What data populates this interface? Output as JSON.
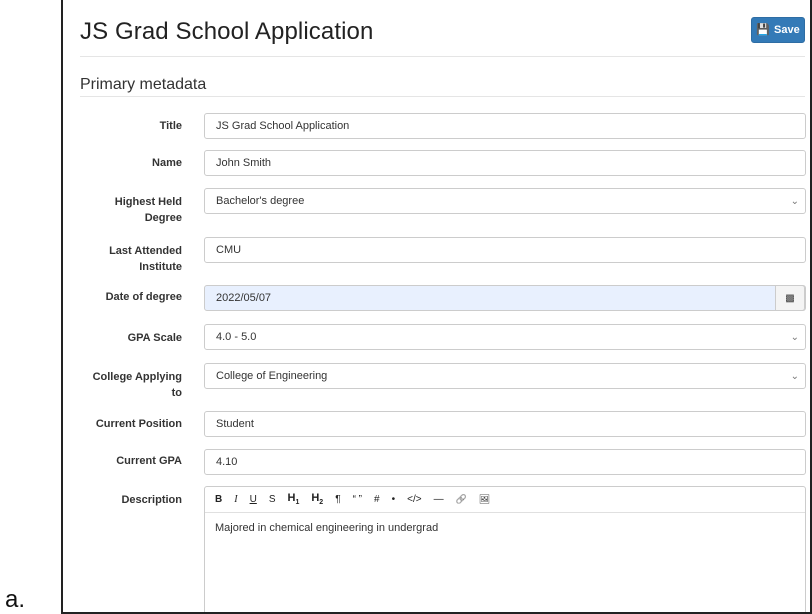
{
  "caption": "a.",
  "header": {
    "title": "JS Grad School Application",
    "save_label": "Save",
    "save_icon": "floppy-disk-icon"
  },
  "section": {
    "title": "Primary metadata"
  },
  "fields": {
    "title": {
      "label": "Title",
      "value": "JS Grad School Application"
    },
    "name": {
      "label": "Name",
      "value": "John Smith"
    },
    "degree": {
      "label1": "Highest Held",
      "label2": "Degree",
      "value": "Bachelor's degree"
    },
    "institute": {
      "label1": "Last Attended",
      "label2": "Institute",
      "value": "CMU"
    },
    "date": {
      "label": "Date of degree",
      "value": "2022/05/07",
      "icon": "calendar-icon"
    },
    "gpa_scale": {
      "label": "GPA Scale",
      "value": "4.0 - 5.0"
    },
    "college": {
      "label1": "College Applying",
      "label2": "to",
      "value": "College of Engineering"
    },
    "position": {
      "label": "Current Position",
      "value": "Student"
    },
    "gpa": {
      "label": "Current GPA",
      "value": "4.10"
    },
    "description": {
      "label": "Description",
      "value": "Majored in chemical engineering in undergrad",
      "toolbar": {
        "bold": "B",
        "italic": "I",
        "underline": "U",
        "strike": "S",
        "h1": "H",
        "h1_sub": "1",
        "h2": "H",
        "h2_sub": "2",
        "paragraph": "¶",
        "quote": "“ ”",
        "hash": "#",
        "bullet": "•",
        "code": "</>",
        "hr": "—",
        "link": "🔗",
        "image": "🖼"
      }
    }
  },
  "colors": {
    "primary": "#337ab7",
    "date_fill": "#e8f0fe"
  }
}
